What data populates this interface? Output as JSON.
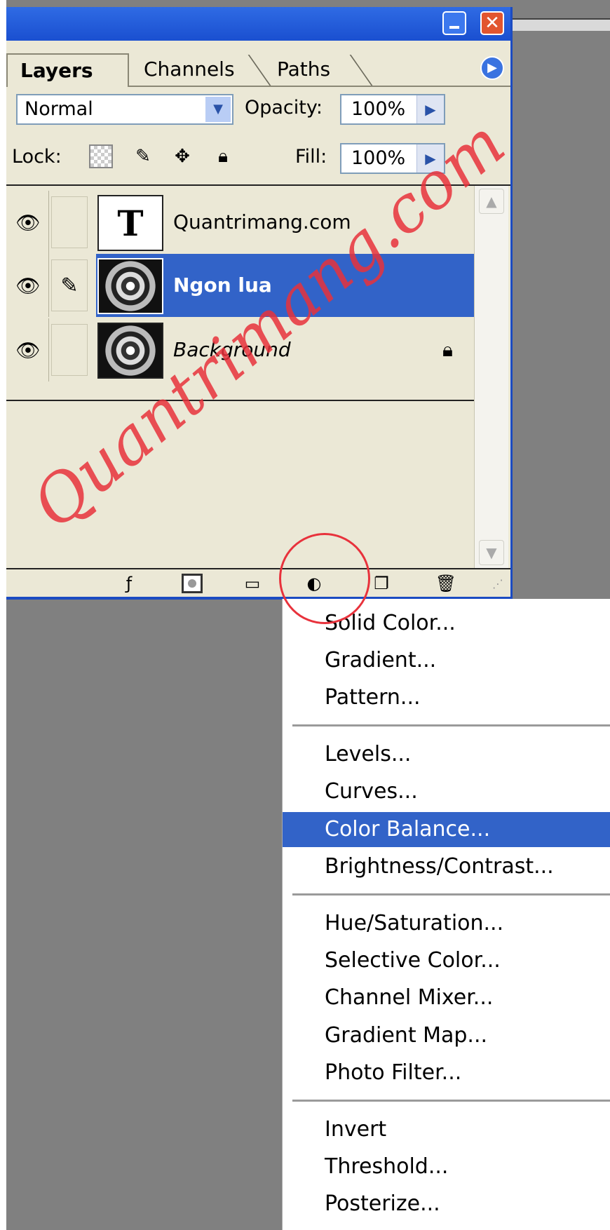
{
  "window": {
    "minimize": "_",
    "close": "✕"
  },
  "tabs": [
    {
      "label": "Layers"
    },
    {
      "label": "Channels"
    },
    {
      "label": "Paths"
    }
  ],
  "blend_mode": {
    "value": "Normal"
  },
  "opacity": {
    "label": "Opacity:",
    "value": "100%"
  },
  "lock": {
    "label": "Lock:"
  },
  "fill": {
    "label": "Fill:",
    "value": "100%"
  },
  "layers": [
    {
      "name": "Quantrimang.com",
      "type": "text",
      "thumb_glyph": "T",
      "selected": false
    },
    {
      "name": "Ngon lua",
      "type": "image",
      "selected": true
    },
    {
      "name": "Background",
      "type": "image",
      "selected": false,
      "locked": true
    }
  ],
  "menu": {
    "groups": [
      [
        "Solid Color...",
        "Gradient...",
        "Pattern..."
      ],
      [
        "Levels...",
        "Curves...",
        "Color Balance...",
        "Brightness/Contrast..."
      ],
      [
        "Hue/Saturation...",
        "Selective Color...",
        "Channel Mixer...",
        "Gradient Map...",
        "Photo Filter..."
      ],
      [
        "Invert",
        "Threshold...",
        "Posterize..."
      ]
    ],
    "highlighted": "Color Balance..."
  },
  "watermark": "Quantrimang.com",
  "colors": {
    "titlebar": "#1a4fd0",
    "selection": "#3263c8",
    "watermark": "#e8323c",
    "panel_bg": "#ebe8d6",
    "canvas_bg": "#808080"
  }
}
